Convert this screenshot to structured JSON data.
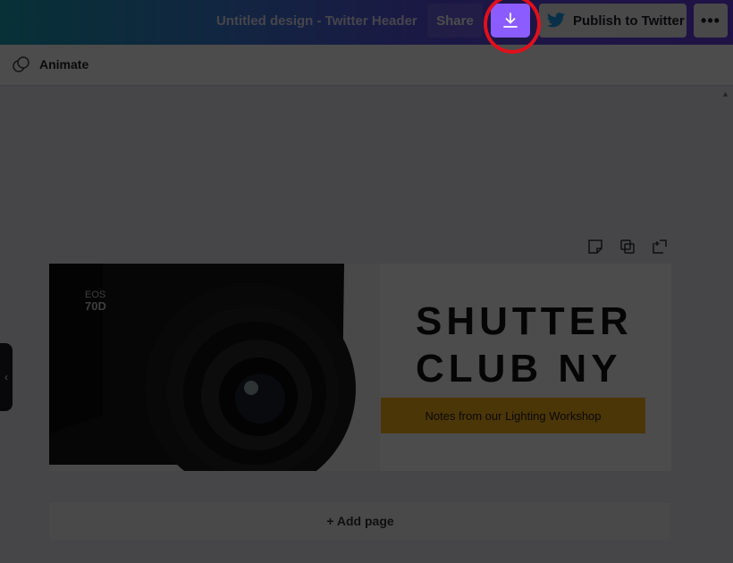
{
  "header": {
    "doc_title": "Untitled design - Twitter Header",
    "share_label": "Share",
    "download_icon": "download-icon",
    "publish_label": "Publish to Twitter",
    "publish_icon": "twitter-bird-icon",
    "more_label": "•••",
    "accent": "#8b5cff",
    "highlight_color": "#e0101c"
  },
  "toolbar": {
    "animate_label": "Animate",
    "animate_icon": "animate-icon"
  },
  "page": {
    "actions": [
      "note-icon",
      "duplicate-icon",
      "add-icon"
    ]
  },
  "design": {
    "brand_line1": "SHUTTER",
    "brand_line2": "CLUB NY",
    "tagline": "Notes from our Lighting Workshop",
    "camera_text_model": "EOS",
    "camera_text_number": "70D",
    "tagline_color": "#fbb41a"
  },
  "footer": {
    "add_page_label": "+ Add page"
  },
  "side_tab_label": "‹"
}
